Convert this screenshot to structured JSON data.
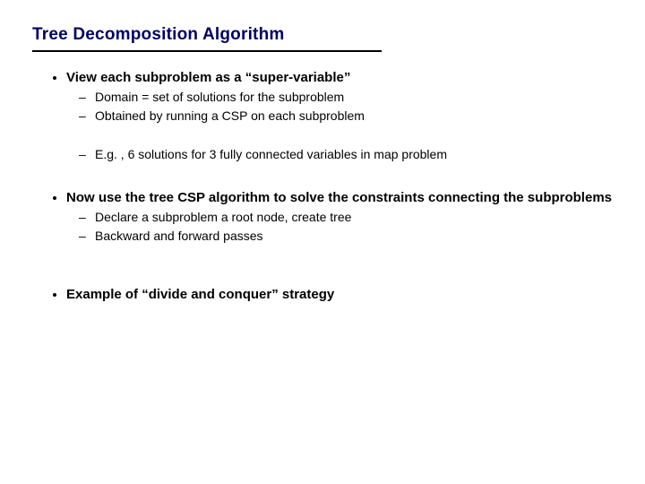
{
  "title": "Tree Decomposition Algorithm",
  "bullets": [
    {
      "text": "View each subproblem as a “super-variable”",
      "bold": true,
      "sub": [
        {
          "text": "Domain = set of solutions for the subproblem"
        },
        {
          "text": "Obtained by running a CSP on each subproblem"
        },
        {
          "text": "E.g. , 6 solutions for 3 fully connected variables in map problem",
          "gap": true
        }
      ]
    },
    {
      "text": "Now use the tree CSP algorithm to solve the constraints connecting the subproblems",
      "bold": true,
      "sub": [
        {
          "text": "Declare a subproblem a root node, create tree"
        },
        {
          "text": "Backward and forward passes"
        }
      ]
    },
    {
      "text": "Example of “divide and conquer” strategy",
      "bold": true,
      "extraSpace": true
    }
  ]
}
